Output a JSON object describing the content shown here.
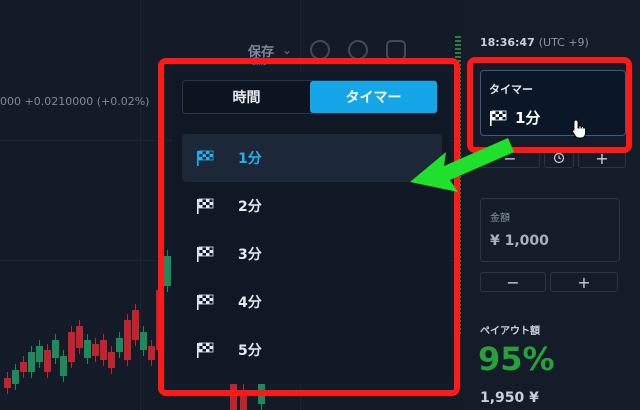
{
  "chart": {
    "price_prefix": "000",
    "price_change": "+0.0210000 (+0.02%)"
  },
  "toolbar": {
    "save_label": "保存",
    "save_sub": "保存"
  },
  "dropdown": {
    "tabs": [
      {
        "label": "時間",
        "active": false
      },
      {
        "label": "タイマー",
        "active": true
      }
    ],
    "options": [
      {
        "label": "1分",
        "selected": true
      },
      {
        "label": "2分",
        "selected": false
      },
      {
        "label": "3分",
        "selected": false
      },
      {
        "label": "4分",
        "selected": false
      },
      {
        "label": "5分",
        "selected": false
      }
    ]
  },
  "side": {
    "clock": "18:36:47",
    "timezone": "(UTC +9)",
    "timer_title": "タイマー",
    "timer_value": "1分",
    "amount_title": "金額",
    "amount_value": "¥ 1,000",
    "minus": "−",
    "plus": "+",
    "payout_title": "ペイアウト額",
    "payout_percent": "95%",
    "payout_amount": "1,950 ¥"
  },
  "colors": {
    "accent": "#14a6e8",
    "highlight": "#ff1a1a",
    "arrow": "#1fe02a",
    "payout": "#25a33a"
  }
}
